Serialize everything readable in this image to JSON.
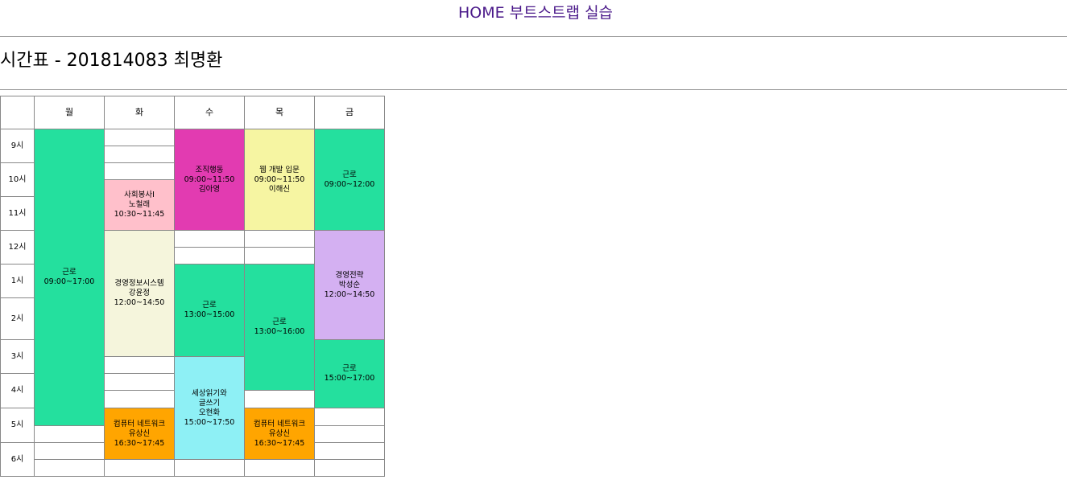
{
  "nav": {
    "home_label": "HOME 부트스트랩 실습"
  },
  "page": {
    "title": "시간표 - 201814083 최명환"
  },
  "timetable": {
    "days": [
      "월",
      "화",
      "수",
      "목",
      "금"
    ],
    "times": [
      "9시",
      "10시",
      "11시",
      "12시",
      "1시",
      "2시",
      "3시",
      "4시",
      "5시",
      "6시"
    ],
    "events": [
      {
        "day": "월",
        "lines": [
          "근로",
          "09:00~17:00"
        ],
        "color": "#24e09e"
      },
      {
        "day": "화",
        "lines": [
          "사회봉사I",
          "노철래",
          "10:30~11:45"
        ],
        "color": "#ffc0cb"
      },
      {
        "day": "화",
        "lines": [
          "경영정보시스템",
          "강윤정",
          "12:00~14:50"
        ],
        "color": "#f5f5dc"
      },
      {
        "day": "화",
        "lines": [
          "컴퓨터 네트워크",
          "유상신",
          "16:30~17:45"
        ],
        "color": "#ffa500"
      },
      {
        "day": "수",
        "lines": [
          "조직행동",
          "09:00~11:50",
          "김아영"
        ],
        "color": "#e23bb1"
      },
      {
        "day": "수",
        "lines": [
          "근로",
          "13:00~15:00"
        ],
        "color": "#24e09e"
      },
      {
        "day": "수",
        "lines": [
          "세상읽기와",
          "글쓰기",
          "오현화",
          "15:00~17:50"
        ],
        "color": "#8ef0f5"
      },
      {
        "day": "목",
        "lines": [
          "웹 개발 입문",
          "09:00~11:50",
          "이해신"
        ],
        "color": "#f6f5a2"
      },
      {
        "day": "목",
        "lines": [
          "근로",
          "13:00~16:00"
        ],
        "color": "#24e09e"
      },
      {
        "day": "목",
        "lines": [
          "컴퓨터 네트워크",
          "유상신",
          "16:30~17:45"
        ],
        "color": "#ffa500"
      },
      {
        "day": "금",
        "lines": [
          "근로",
          "09:00~12:00"
        ],
        "color": "#24e09e"
      },
      {
        "day": "금",
        "lines": [
          "경영전략",
          "박성순",
          "12:00~14:50"
        ],
        "color": "#d4b0f2"
      },
      {
        "day": "금",
        "lines": [
          "근로",
          "15:00~17:00"
        ],
        "color": "#24e09e"
      }
    ]
  }
}
